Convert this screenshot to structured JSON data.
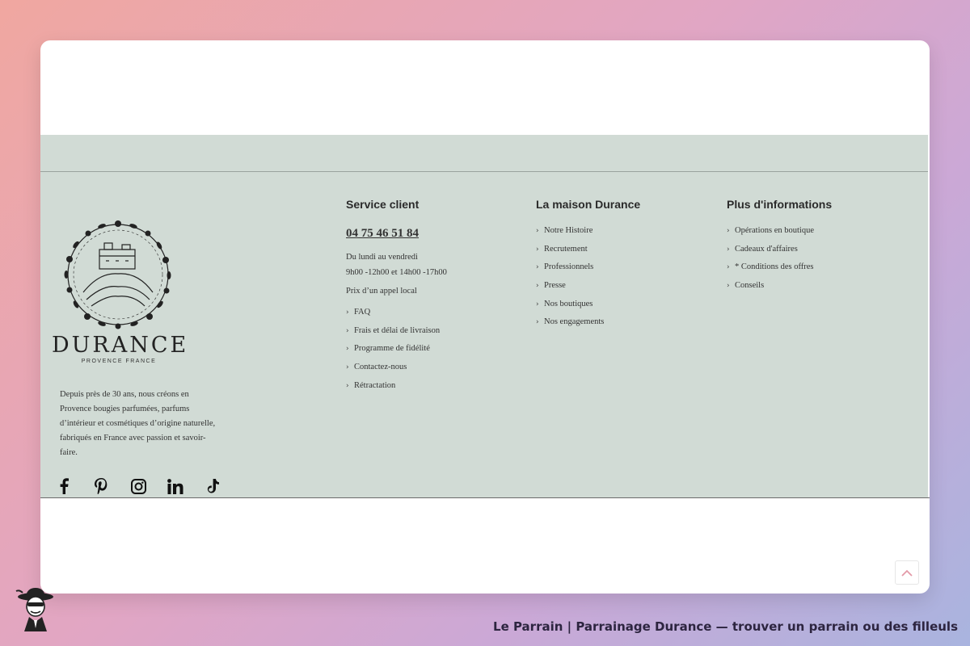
{
  "brand": {
    "name": "DURANCE",
    "subtitle": "PROVENCE FRANCE",
    "about": "Depuis près de 30 ans, nous créons en Provence bougies parfumées, parfums d’intérieur et cosmétiques d’origine naturelle, fabriqués en France avec passion et savoir-faire."
  },
  "socials": [
    "facebook-icon",
    "pinterest-icon",
    "instagram-icon",
    "linkedin-icon",
    "tiktok-icon"
  ],
  "service": {
    "title": "Service client",
    "phone": "04 75 46 51 84",
    "hours_line1": "Du lundi au vendredi",
    "hours_line2": "9h00 -12h00 et 14h00 -17h00",
    "note": "Prix d’un appel local",
    "links": [
      "FAQ",
      "Frais et délai de livraison",
      "Programme de fidélité",
      "Contactez-nous",
      "Rétractation"
    ]
  },
  "maison": {
    "title": "La maison Durance",
    "links": [
      "Notre Histoire",
      "Recrutement",
      "Professionnels",
      "Presse",
      "Nos boutiques",
      "Nos engagements"
    ]
  },
  "infos": {
    "title": "Plus d'informations",
    "links": [
      "Opérations en boutique",
      "Cadeaux d'affaires",
      "* Conditions des offres",
      "Conseils"
    ]
  },
  "caption": "Le Parrain | Parrainage Durance — trouver un parrain ou des filleuls",
  "colors": {
    "footer_bg": "#d1dbd5",
    "accent": "#e39aa8"
  }
}
